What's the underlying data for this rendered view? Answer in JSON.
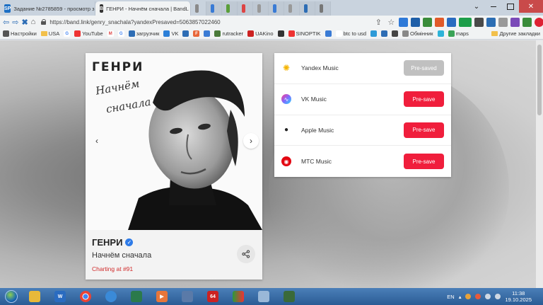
{
  "browser": {
    "tabs": [
      {
        "label": "Задание №2785859 - просмотр з",
        "favicon": "SP",
        "color": "#1c6fc4"
      },
      {
        "label": "ГЕНРИ - Начнём сначала | BandL",
        "favicon": "B",
        "color": "#333333"
      },
      {
        "label": "",
        "favicon": "",
        "color": "#8a8a8a"
      }
    ],
    "url": "https://band.link/genry_snachala?yandexPresaved=5063857022460",
    "bookmarks": [
      "Настройки",
      "USA",
      "G",
      "YouTube",
      "M",
      "G",
      "загрузчик",
      "VK",
      "",
      "F",
      "",
      "rutracker",
      "UAKino",
      "",
      "SINOPTIK",
      "",
      "btc to usd",
      "",
      "",
      "",
      "Обмінник",
      "",
      "maps"
    ],
    "other_bookmarks": "Другие закладки"
  },
  "release": {
    "cover_title": "ГЕНРИ",
    "cover_script_line1": "Начнём",
    "cover_script_line2": "сначала",
    "artist": "ГЕНРИ",
    "title": "Начнём сначала",
    "charting": "Charting at #91"
  },
  "services": [
    {
      "name": "Yandex Music",
      "button": "Pre-saved",
      "saved": true,
      "color": "#ffcc00"
    },
    {
      "name": "VK Music",
      "button": "Pre-save",
      "saved": false,
      "color": "#7f6bff"
    },
    {
      "name": "Apple Music",
      "button": "Pre-save",
      "saved": false,
      "color": "#222222"
    },
    {
      "name": "MTC Music",
      "button": "Pre-save",
      "saved": false,
      "color": "#e30611"
    }
  ],
  "taskbar": {
    "lang": "EN",
    "time": "11:38",
    "date": "19.10.2025",
    "badge": "64"
  }
}
